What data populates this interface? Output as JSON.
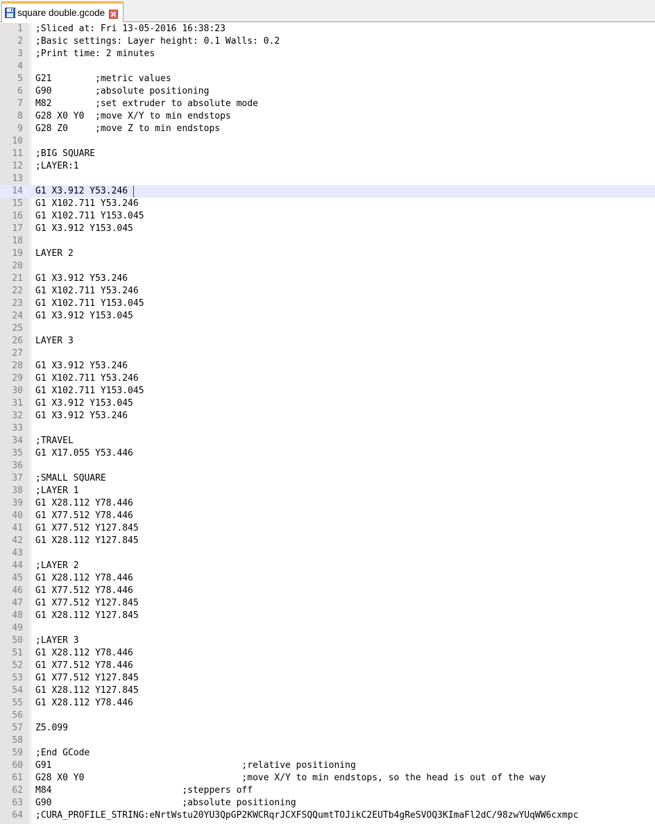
{
  "tab": {
    "filename": "square double.gcode",
    "icon": "save-disk-icon",
    "close_icon": "close-icon",
    "accent_color": "#f7b44a"
  },
  "editor": {
    "current_line": 14,
    "lines": [
      {
        "n": "1",
        "text": ";Sliced at: Fri 13-05-2016 16:38:23"
      },
      {
        "n": "2",
        "text": ";Basic settings: Layer height: 0.1 Walls: 0.2"
      },
      {
        "n": "3",
        "text": ";Print time: 2 minutes"
      },
      {
        "n": "4",
        "text": ""
      },
      {
        "n": "5",
        "text": "G21        ;metric values"
      },
      {
        "n": "6",
        "text": "G90        ;absolute positioning"
      },
      {
        "n": "7",
        "text": "M82        ;set extruder to absolute mode"
      },
      {
        "n": "8",
        "text": "G28 X0 Y0  ;move X/Y to min endstops"
      },
      {
        "n": "9",
        "text": "G28 Z0     ;move Z to min endstops"
      },
      {
        "n": "10",
        "text": ""
      },
      {
        "n": "11",
        "text": ";BIG SQUARE"
      },
      {
        "n": "12",
        "text": ";LAYER:1"
      },
      {
        "n": "13",
        "text": ""
      },
      {
        "n": "14",
        "text": "G1 X3.912 Y53.246 "
      },
      {
        "n": "15",
        "text": "G1 X102.711 Y53.246"
      },
      {
        "n": "16",
        "text": "G1 X102.711 Y153.045"
      },
      {
        "n": "17",
        "text": "G1 X3.912 Y153.045"
      },
      {
        "n": "18",
        "text": ""
      },
      {
        "n": "19",
        "text": "LAYER 2"
      },
      {
        "n": "20",
        "text": ""
      },
      {
        "n": "21",
        "text": "G1 X3.912 Y53.246"
      },
      {
        "n": "22",
        "text": "G1 X102.711 Y53.246"
      },
      {
        "n": "23",
        "text": "G1 X102.711 Y153.045"
      },
      {
        "n": "24",
        "text": "G1 X3.912 Y153.045"
      },
      {
        "n": "25",
        "text": ""
      },
      {
        "n": "26",
        "text": "LAYER 3"
      },
      {
        "n": "27",
        "text": ""
      },
      {
        "n": "28",
        "text": "G1 X3.912 Y53.246"
      },
      {
        "n": "29",
        "text": "G1 X102.711 Y53.246"
      },
      {
        "n": "30",
        "text": "G1 X102.711 Y153.045"
      },
      {
        "n": "31",
        "text": "G1 X3.912 Y153.045"
      },
      {
        "n": "32",
        "text": "G1 X3.912 Y53.246"
      },
      {
        "n": "33",
        "text": ""
      },
      {
        "n": "34",
        "text": ";TRAVEL"
      },
      {
        "n": "35",
        "text": "G1 X17.055 Y53.446"
      },
      {
        "n": "36",
        "text": ""
      },
      {
        "n": "37",
        "text": ";SMALL SQUARE"
      },
      {
        "n": "38",
        "text": ";LAYER 1"
      },
      {
        "n": "39",
        "text": "G1 X28.112 Y78.446"
      },
      {
        "n": "40",
        "text": "G1 X77.512 Y78.446"
      },
      {
        "n": "41",
        "text": "G1 X77.512 Y127.845"
      },
      {
        "n": "42",
        "text": "G1 X28.112 Y127.845"
      },
      {
        "n": "43",
        "text": ""
      },
      {
        "n": "44",
        "text": ";LAYER 2"
      },
      {
        "n": "45",
        "text": "G1 X28.112 Y78.446"
      },
      {
        "n": "46",
        "text": "G1 X77.512 Y78.446"
      },
      {
        "n": "47",
        "text": "G1 X77.512 Y127.845"
      },
      {
        "n": "48",
        "text": "G1 X28.112 Y127.845"
      },
      {
        "n": "49",
        "text": ""
      },
      {
        "n": "50",
        "text": ";LAYER 3"
      },
      {
        "n": "51",
        "text": "G1 X28.112 Y78.446"
      },
      {
        "n": "52",
        "text": "G1 X77.512 Y78.446"
      },
      {
        "n": "53",
        "text": "G1 X77.512 Y127.845"
      },
      {
        "n": "54",
        "text": "G1 X28.112 Y127.845"
      },
      {
        "n": "55",
        "text": "G1 X28.112 Y78.446"
      },
      {
        "n": "56",
        "text": ""
      },
      {
        "n": "57",
        "text": "Z5.099"
      },
      {
        "n": "58",
        "text": ""
      },
      {
        "n": "59",
        "text": ";End GCode"
      },
      {
        "n": "60",
        "text": "G91                                   ;relative positioning"
      },
      {
        "n": "61",
        "text": "G28 X0 Y0                             ;move X/Y to min endstops, so the head is out of the way"
      },
      {
        "n": "62",
        "text": "M84                        ;steppers off"
      },
      {
        "n": "63",
        "text": "G90                        ;absolute positioning"
      },
      {
        "n": "64",
        "text": ";CURA_PROFILE_STRING:eNrtWstu20YU3QpGP2KWCRqrJCXFSQQumtTOJikC2EUTb4gReSVOQ3KImaFl2dC/98zwYUqWW6cxmpc"
      }
    ]
  }
}
